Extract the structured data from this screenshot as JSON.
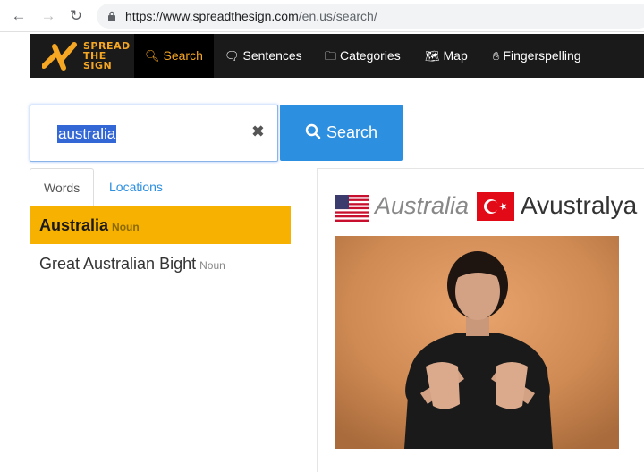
{
  "browser": {
    "back_icon": "arrow-left-icon",
    "forward_icon": "arrow-right-icon",
    "reload_icon": "reload-icon",
    "url_host": "https://www.spreadthesign.com",
    "url_path": "/en.us/search/"
  },
  "site": {
    "logo_line1": "SPREAD",
    "logo_line2": "THE",
    "logo_line3": "SIGN",
    "nav": {
      "search": "Search",
      "sentences": "Sentences",
      "categories": "Categories",
      "map": "Map",
      "fingerspelling": "Fingerspelling"
    },
    "accent_color": "#f5a623"
  },
  "search": {
    "value": "australia",
    "button_label": "Search"
  },
  "tabs": {
    "words": "Words",
    "locations": "Locations"
  },
  "results": [
    {
      "word": "Australia",
      "pos": "Noun"
    },
    {
      "word": "Great Australian Bight",
      "pos": "Noun"
    }
  ],
  "detail": {
    "source_word": "Australia",
    "target_word": "Avustralya",
    "source_flag": "us-flag-icon",
    "target_flag": "turkey-flag-icon"
  }
}
